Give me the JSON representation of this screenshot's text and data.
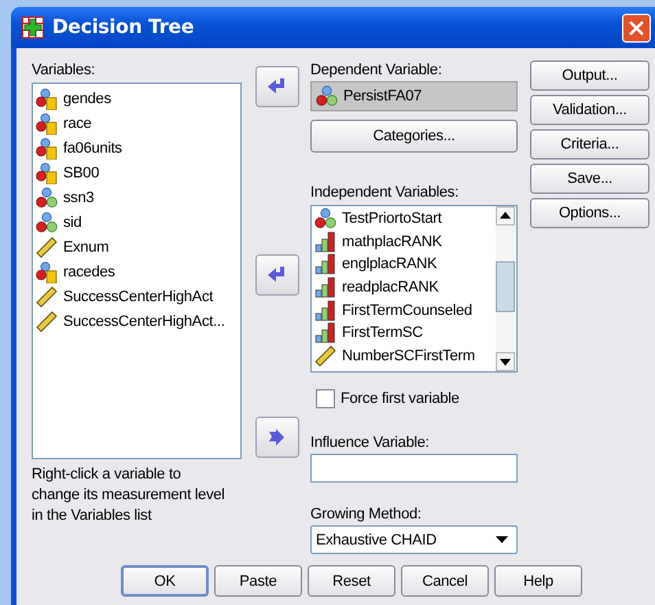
{
  "window": {
    "title": "Decision Tree"
  },
  "variables": {
    "label": "Variables:",
    "items": [
      {
        "name": "gendes",
        "kind": "string"
      },
      {
        "name": "race",
        "kind": "string"
      },
      {
        "name": "fa06units",
        "kind": "string"
      },
      {
        "name": "SB00",
        "kind": "string"
      },
      {
        "name": "ssn3",
        "kind": "nominal"
      },
      {
        "name": "sid",
        "kind": "nominal"
      },
      {
        "name": "Exnum",
        "kind": "scale"
      },
      {
        "name": "racedes",
        "kind": "string"
      },
      {
        "name": "SuccessCenterHighAct",
        "kind": "scale"
      },
      {
        "name": "SuccessCenterHighAct...",
        "kind": "scale"
      }
    ],
    "hint": "Right-click a variable to change its measurement level in the Variables list"
  },
  "dependent": {
    "label": "Dependent Variable:",
    "value": "PersistFA07",
    "kind": "nominal"
  },
  "categories_button": "Categories...",
  "independent": {
    "label": "Independent Variables:",
    "items": [
      {
        "name": "TestPriortoStart",
        "kind": "nominal"
      },
      {
        "name": "mathplacRANK",
        "kind": "ordinal"
      },
      {
        "name": "englplacRANK",
        "kind": "ordinal"
      },
      {
        "name": "readplacRANK",
        "kind": "ordinal"
      },
      {
        "name": "FirstTermCounseled",
        "kind": "ordinal"
      },
      {
        "name": "FirstTermSC",
        "kind": "ordinal"
      },
      {
        "name": "NumberSCFirstTerm",
        "kind": "scale"
      }
    ]
  },
  "force_first": {
    "label": "Force first variable",
    "checked": false
  },
  "influence": {
    "label": "Influence Variable:"
  },
  "growing": {
    "label": "Growing Method:",
    "value": "Exhaustive CHAID"
  },
  "side_buttons": [
    "Output...",
    "Validation...",
    "Criteria...",
    "Save...",
    "Options..."
  ],
  "bottom_buttons": [
    {
      "label": "OK",
      "default": true
    },
    {
      "label": "Paste",
      "default": false
    },
    {
      "label": "Reset",
      "default": false
    },
    {
      "label": "Cancel",
      "default": false
    },
    {
      "label": "Help",
      "default": false
    }
  ]
}
